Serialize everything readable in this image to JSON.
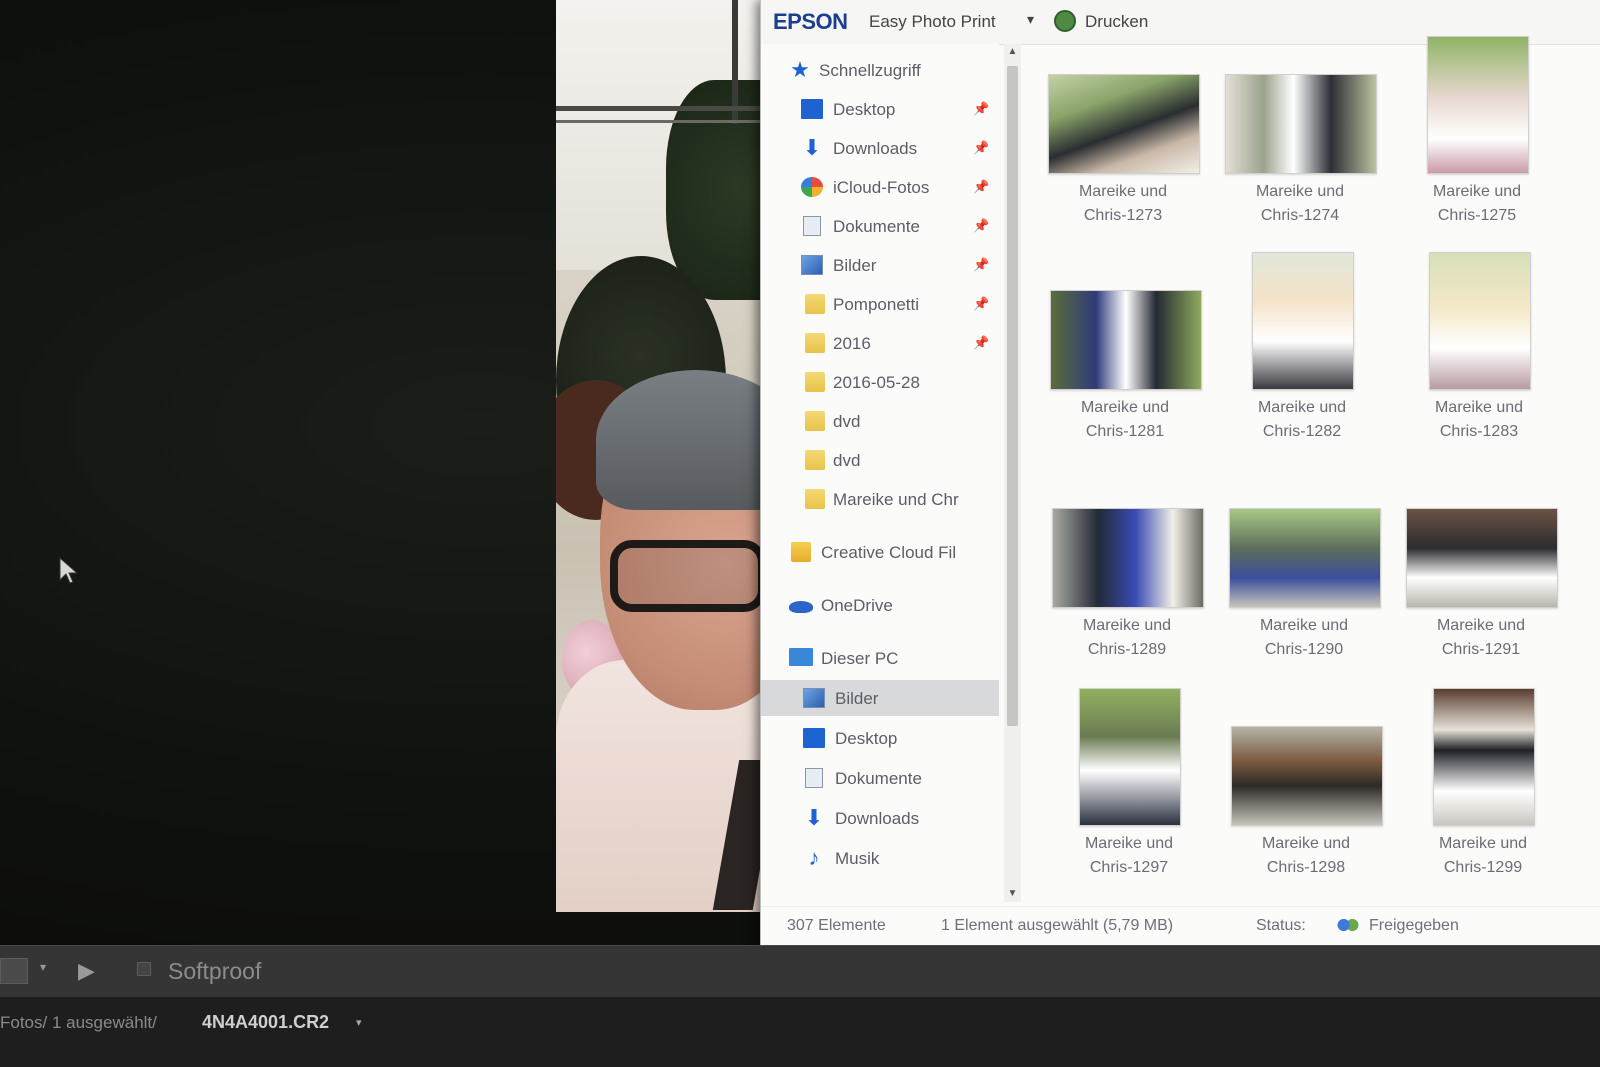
{
  "epson_bar": {
    "logo": "EPSON",
    "app_name": "Easy Photo Print",
    "dropdown_glyph": "▾",
    "print_label": "Drucken"
  },
  "nav": {
    "items": [
      {
        "label": "Schnellzugriff",
        "icon": "pin-star-icon"
      },
      {
        "label": "Desktop",
        "icon": "desktop-icon",
        "pinned": true
      },
      {
        "label": "Downloads",
        "icon": "download-arrow-icon",
        "pinned": true
      },
      {
        "label": "iCloud-Fotos",
        "icon": "icloud-photos-icon",
        "pinned": true
      },
      {
        "label": "Dokumente",
        "icon": "documents-icon",
        "pinned": true
      },
      {
        "label": "Bilder",
        "icon": "pictures-icon",
        "pinned": true
      },
      {
        "label": "Pomponetti",
        "icon": "folder-icon",
        "pinned": true
      },
      {
        "label": "2016",
        "icon": "folder-icon",
        "pinned": true
      },
      {
        "label": "2016-05-28",
        "icon": "folder-icon"
      },
      {
        "label": "dvd",
        "icon": "folder-icon"
      },
      {
        "label": "dvd",
        "icon": "folder-icon"
      },
      {
        "label": "Mareike und Chr",
        "icon": "folder-icon"
      },
      {
        "label": "Creative Cloud Fil",
        "icon": "creative-cloud-folder-icon"
      },
      {
        "label": "OneDrive",
        "icon": "onedrive-cloud-icon"
      },
      {
        "label": "Dieser PC",
        "icon": "computer-icon"
      },
      {
        "label": "Bilder",
        "icon": "pictures-icon",
        "selected": true
      },
      {
        "label": "Desktop",
        "icon": "desktop-icon"
      },
      {
        "label": "Dokumente",
        "icon": "documents-icon"
      },
      {
        "label": "Downloads",
        "icon": "download-arrow-icon"
      },
      {
        "label": "Musik",
        "icon": "music-note-icon"
      }
    ],
    "pin_glyph": "📌"
  },
  "thumbnails": [
    {
      "line1": "Mareike und",
      "line2": "Chris-1273"
    },
    {
      "line1": "Mareike und",
      "line2": "Chris-1274"
    },
    {
      "line1": "Mareike und",
      "line2": "Chris-1275"
    },
    {
      "line1": "Mareike und",
      "line2": "Chris-1281"
    },
    {
      "line1": "Mareike und",
      "line2": "Chris-1282"
    },
    {
      "line1": "Mareike und",
      "line2": "Chris-1283"
    },
    {
      "line1": "Mareike und",
      "line2": "Chris-1289"
    },
    {
      "line1": "Mareike und",
      "line2": "Chris-1290"
    },
    {
      "line1": "Mareike und",
      "line2": "Chris-1291"
    },
    {
      "line1": "Mareike und",
      "line2": "Chris-1297"
    },
    {
      "line1": "Mareike und",
      "line2": "Chris-1298"
    },
    {
      "line1": "Mareike und",
      "line2": "Chris-1299"
    }
  ],
  "statusbar": {
    "count": "307 Elemente",
    "selection": "1 Element ausgewählt (5,79 MB)",
    "status_label": "Status:",
    "status_value": "Freigegeben"
  },
  "lr_toolbar": {
    "dropdown_glyph": "▾",
    "play_glyph": "▶",
    "softproof_label": "Softproof"
  },
  "lr_filmbar": {
    "path": "Fotos/ 1 ausgewählt/",
    "filename": "4N4A4001.CR2",
    "dropdown_glyph": "▾"
  },
  "colors": {
    "epson_blue": "#1b3f8f",
    "accent_blue": "#1e63d2",
    "selection_gray": "#d7d9db"
  }
}
